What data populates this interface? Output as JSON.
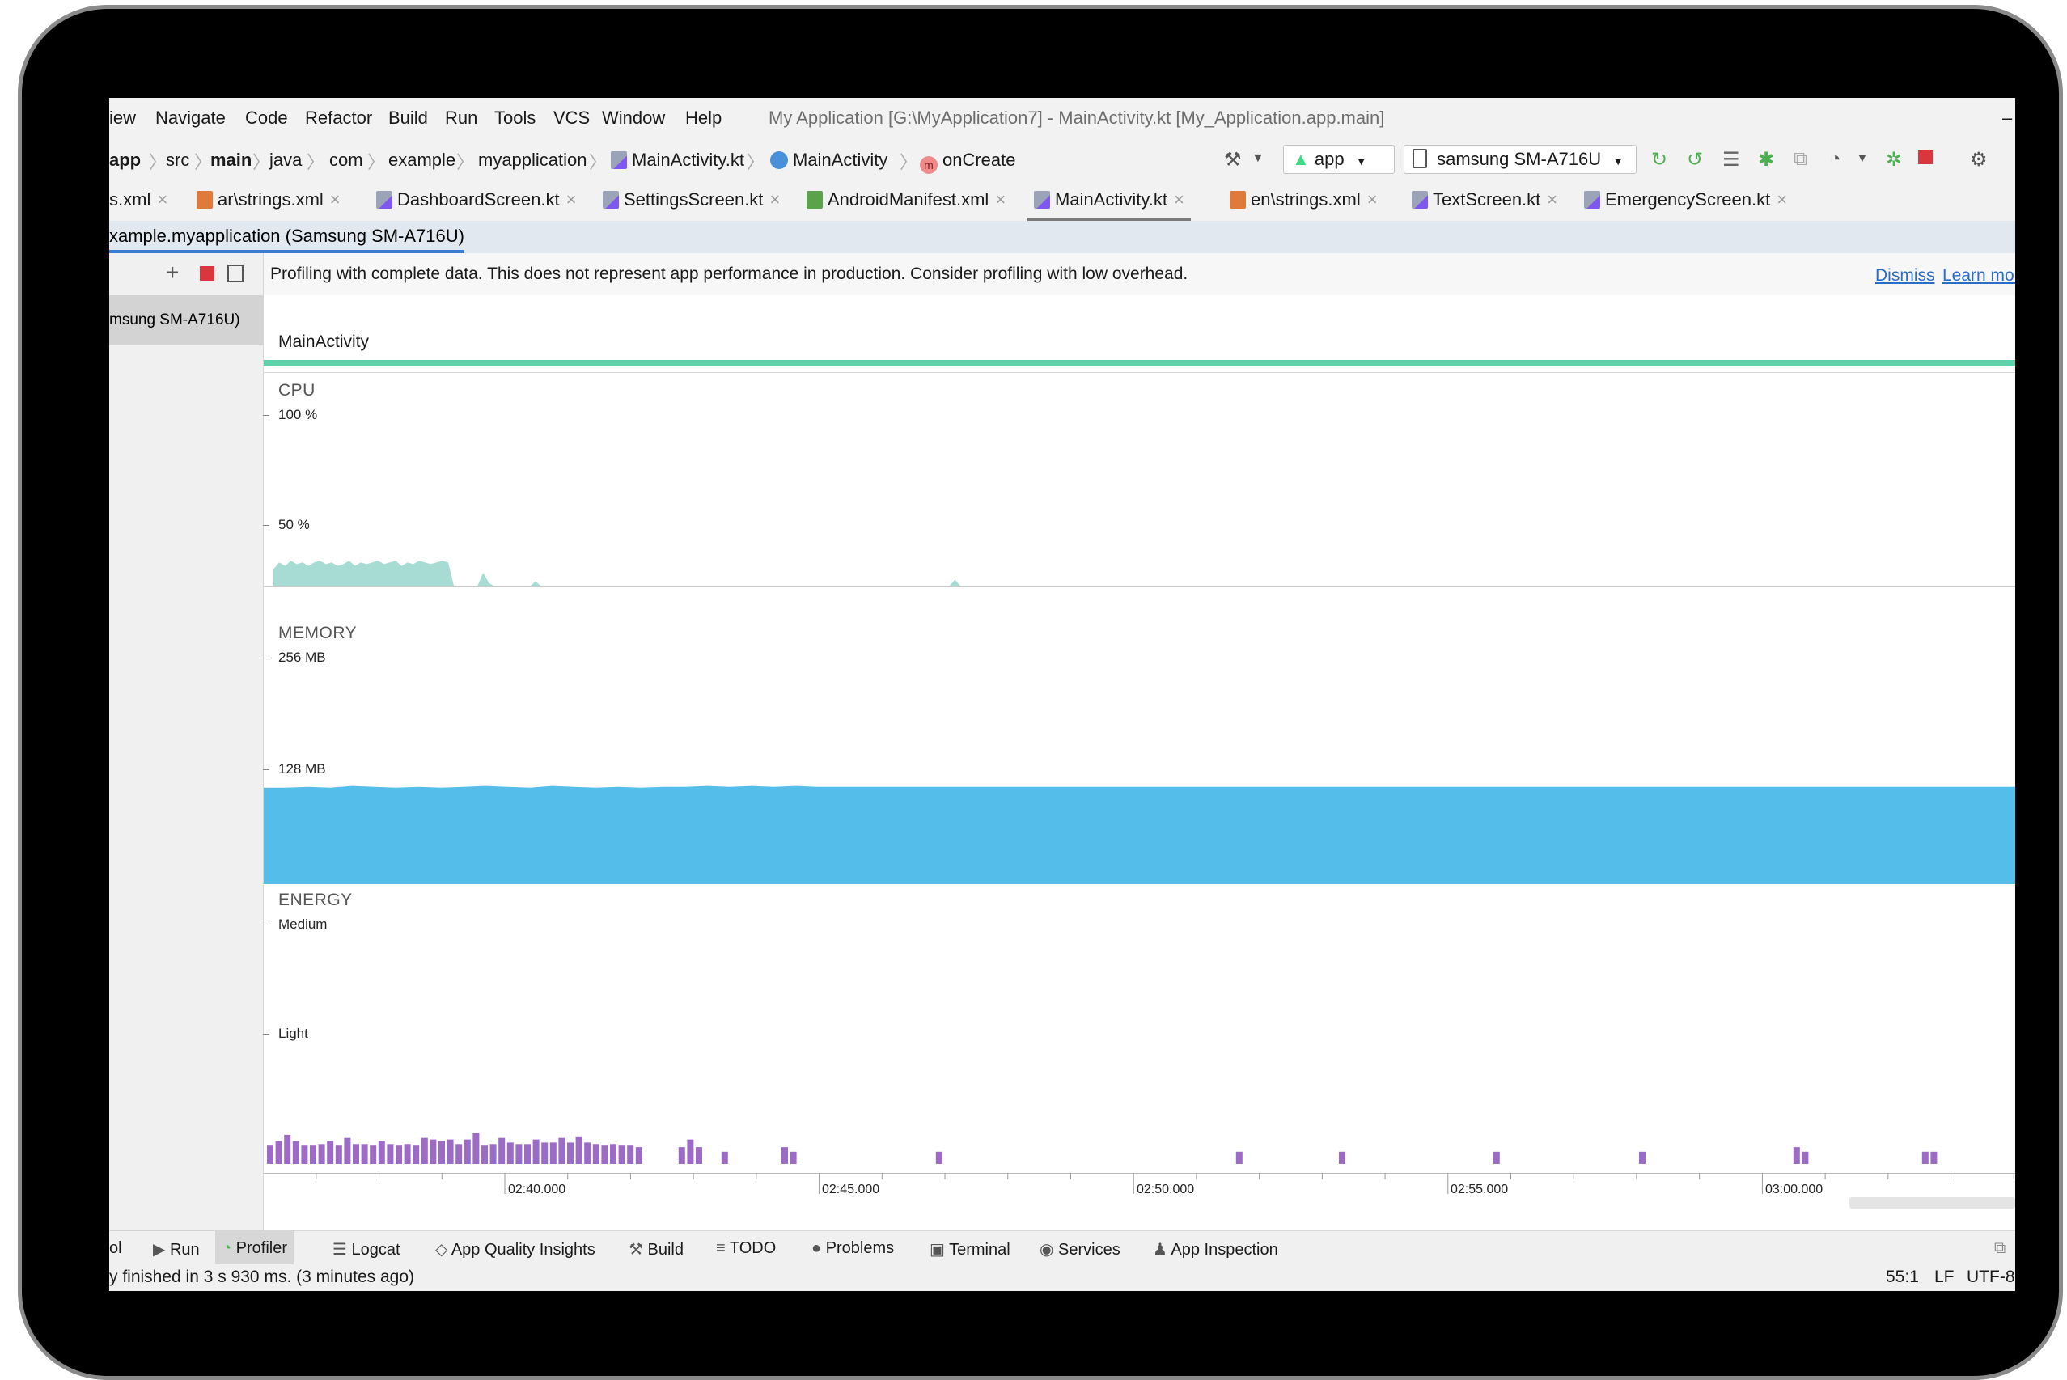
{
  "menubar": {
    "items": [
      "iew",
      "Navigate",
      "Code",
      "Refactor",
      "Build",
      "Run",
      "Tools",
      "VCS",
      "Window",
      "Help"
    ],
    "window_title": "My Application [G:\\MyApplication7] - MainActivity.kt [My_Application.app.main]",
    "minimize": "–"
  },
  "breadcrumb": {
    "items": [
      "app",
      "src",
      "main",
      "java",
      "com",
      "example",
      "myapplication",
      "MainActivity.kt",
      "MainActivity",
      "onCreate"
    ]
  },
  "toolbar": {
    "run_config": "app",
    "device": "samsung SM-A716U"
  },
  "tabs": [
    {
      "label": "s.xml",
      "icon": "xml-file-icon"
    },
    {
      "label": "ar\\strings.xml",
      "icon": "xml-file-icon"
    },
    {
      "label": "DashboardScreen.kt",
      "icon": "kotlin-file-icon"
    },
    {
      "label": "SettingsScreen.kt",
      "icon": "kotlin-file-icon"
    },
    {
      "label": "AndroidManifest.xml",
      "icon": "manifest-file-icon"
    },
    {
      "label": "MainActivity.kt",
      "icon": "kotlin-file-icon",
      "active": true
    },
    {
      "label": "en\\strings.xml",
      "icon": "xml-file-icon"
    },
    {
      "label": "TextScreen.kt",
      "icon": "kotlin-file-icon"
    },
    {
      "label": "EmergencyScreen.kt",
      "icon": "kotlin-file-icon"
    }
  ],
  "session": {
    "label": "xample.myapplication (Samsung SM-A716U)"
  },
  "sidebar": {
    "device_label": "msung SM-A716U)"
  },
  "banner": {
    "text": "Profiling with complete data. This does not represent app performance in production. Consider profiling with low overhead.",
    "dismiss": "Dismiss",
    "learn_more": "Learn more"
  },
  "activity": {
    "label": "MainActivity"
  },
  "cpu": {
    "label": "CPU",
    "ticks": [
      "100 %",
      "50 %"
    ],
    "fill_color": "#a6dcd3",
    "samples": [
      10,
      14,
      12,
      15,
      13,
      14,
      12,
      14,
      15,
      13,
      14,
      12,
      13,
      15,
      12,
      14,
      13,
      14,
      15,
      13,
      14,
      15,
      12,
      14,
      13,
      15,
      14,
      13,
      14,
      15,
      14,
      0,
      0,
      0,
      0,
      0,
      8,
      2,
      0,
      0,
      0,
      0,
      0,
      0,
      0,
      3,
      0,
      0,
      0,
      0,
      0,
      0,
      0,
      0,
      0,
      0,
      0,
      0,
      0,
      0,
      0,
      0,
      0,
      0,
      0,
      0,
      0,
      0,
      0,
      0,
      0,
      0,
      0,
      0,
      0,
      0,
      0,
      0,
      0,
      0,
      0,
      0,
      0,
      0,
      0,
      0,
      0,
      0,
      0,
      0,
      0,
      0,
      0,
      0,
      0,
      0,
      0,
      0,
      0,
      0,
      0,
      0,
      0,
      0,
      0,
      0,
      0,
      0,
      0,
      0,
      0,
      0,
      0,
      0,
      0,
      0,
      0,
      4,
      0,
      0,
      0,
      0,
      0,
      0,
      0,
      0,
      0,
      0,
      0,
      0,
      0,
      0,
      0,
      0,
      0,
      0
    ]
  },
  "memory": {
    "label": "MEMORY",
    "ticks": [
      "256 MB",
      "128 MB"
    ],
    "fill_color": "#55bde9",
    "samples": [
      109,
      109,
      110,
      109,
      111,
      110,
      109,
      110,
      109,
      110,
      111,
      110,
      109,
      111,
      110,
      109,
      110,
      109,
      110,
      110,
      111,
      110,
      111,
      110,
      111,
      110,
      110,
      110,
      110,
      110,
      110,
      110,
      110,
      110,
      110,
      110,
      110,
      110,
      110,
      110,
      110,
      110,
      110,
      110,
      110,
      110,
      110,
      110,
      110,
      110,
      110,
      110,
      110,
      110,
      110,
      110,
      110,
      110,
      110,
      110,
      110,
      110,
      110,
      110,
      110,
      110,
      110,
      110,
      110,
      110,
      110,
      110,
      110,
      110,
      110,
      110,
      110,
      110,
      110,
      110
    ]
  },
  "energy": {
    "label": "ENERGY",
    "ticks": [
      "Medium",
      "Light"
    ],
    "bar_color": "#9c6bc6",
    "bars": [
      [
        0,
        12
      ],
      [
        1,
        15
      ],
      [
        2,
        19
      ],
      [
        3,
        15
      ],
      [
        4,
        12
      ],
      [
        5,
        12
      ],
      [
        6,
        13
      ],
      [
        7,
        15
      ],
      [
        8,
        12
      ],
      [
        9,
        17
      ],
      [
        10,
        13
      ],
      [
        11,
        13
      ],
      [
        12,
        12
      ],
      [
        13,
        15
      ],
      [
        14,
        13
      ],
      [
        15,
        12
      ],
      [
        16,
        13
      ],
      [
        17,
        12
      ],
      [
        18,
        17
      ],
      [
        19,
        16
      ],
      [
        20,
        15
      ],
      [
        21,
        16
      ],
      [
        22,
        13
      ],
      [
        23,
        16
      ],
      [
        24,
        20
      ],
      [
        25,
        12
      ],
      [
        26,
        13
      ],
      [
        27,
        17
      ],
      [
        28,
        14
      ],
      [
        29,
        13
      ],
      [
        30,
        13
      ],
      [
        31,
        16
      ],
      [
        32,
        14
      ],
      [
        33,
        14
      ],
      [
        34,
        17
      ],
      [
        35,
        14
      ],
      [
        36,
        18
      ],
      [
        37,
        14
      ],
      [
        38,
        13
      ],
      [
        39,
        12
      ],
      [
        40,
        13
      ],
      [
        41,
        12
      ],
      [
        42,
        12
      ],
      [
        43,
        11
      ],
      [
        48,
        11
      ],
      [
        49,
        16
      ],
      [
        50,
        11
      ],
      [
        53,
        8
      ],
      [
        60,
        11
      ],
      [
        61,
        8
      ],
      [
        78,
        8
      ],
      [
        113,
        8
      ],
      [
        125,
        8
      ],
      [
        143,
        8
      ],
      [
        160,
        8
      ],
      [
        178,
        11
      ],
      [
        179,
        8
      ],
      [
        193,
        8
      ],
      [
        194,
        8
      ]
    ]
  },
  "timeline": {
    "labels": [
      "02:40.000",
      "02:45.000",
      "02:50.000",
      "02:55.000",
      "03:00.000"
    ]
  },
  "bottom_tools": [
    {
      "label": "ol",
      "icon": ""
    },
    {
      "label": "Run",
      "icon": "run-icon"
    },
    {
      "label": "Profiler",
      "icon": "profiler-icon",
      "active": true
    },
    {
      "label": "Logcat",
      "icon": "logcat-icon"
    },
    {
      "label": "App Quality Insights",
      "icon": "app-quality-icon"
    },
    {
      "label": "Build",
      "icon": "build-hammer-icon"
    },
    {
      "label": "TODO",
      "icon": "todo-icon"
    },
    {
      "label": "Problems",
      "icon": "problems-icon"
    },
    {
      "label": "Terminal",
      "icon": "terminal-icon"
    },
    {
      "label": "Services",
      "icon": "services-icon"
    },
    {
      "label": "App Inspection",
      "icon": "app-inspection-icon"
    }
  ],
  "status": {
    "message": "y finished in 3 s 930 ms. (3 minutes ago)",
    "position": "55:1",
    "line_separator": "LF",
    "encoding": "UTF-8"
  }
}
